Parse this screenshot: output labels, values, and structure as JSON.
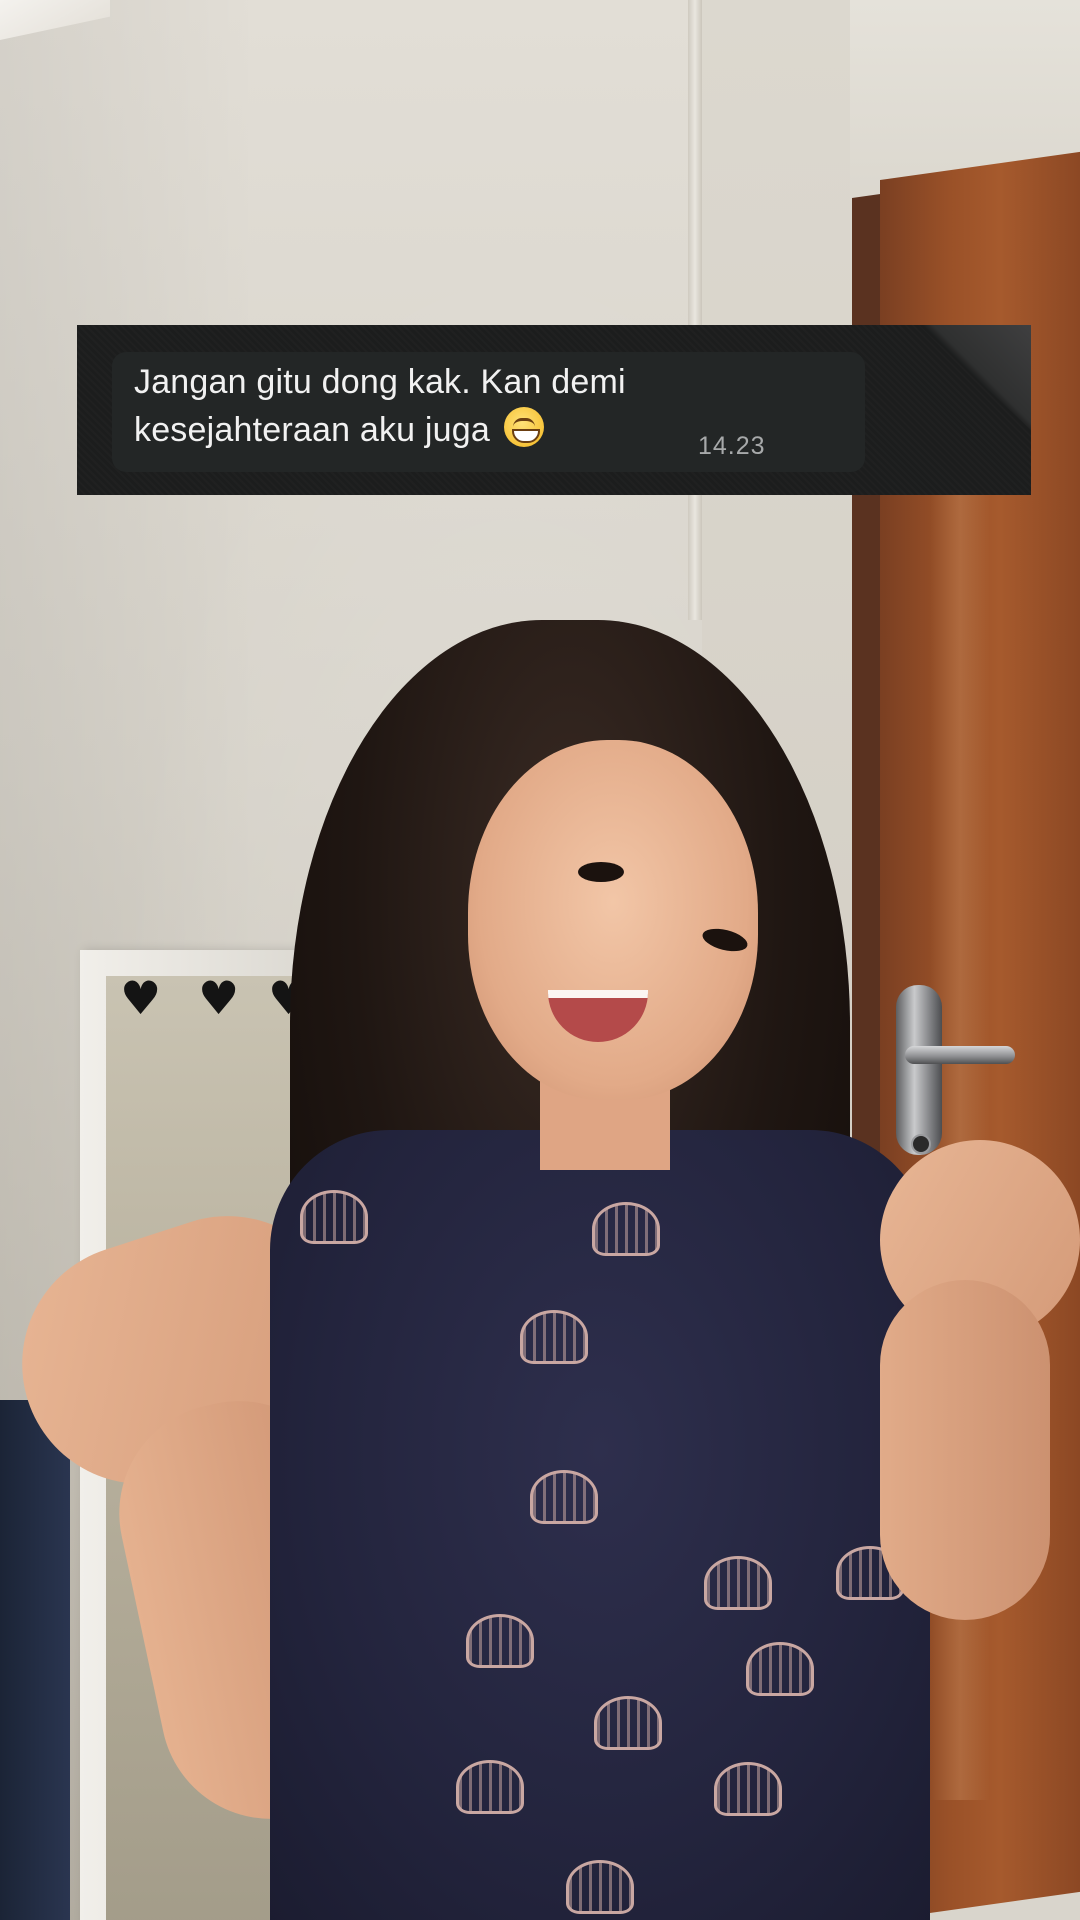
{
  "message": {
    "text": "Jangan gitu dong kak. Kan demi kesejahteraan aku juga",
    "emoji": "beaming-face-with-smiling-eyes",
    "time": "14.23"
  },
  "colors": {
    "card_background": "#1c1d1d",
    "bubble_background": "#232626",
    "message_text": "#f1f1f1",
    "timestamp_text": "#a7a9aa",
    "door": "#9a5128",
    "dress": "#23243d"
  }
}
